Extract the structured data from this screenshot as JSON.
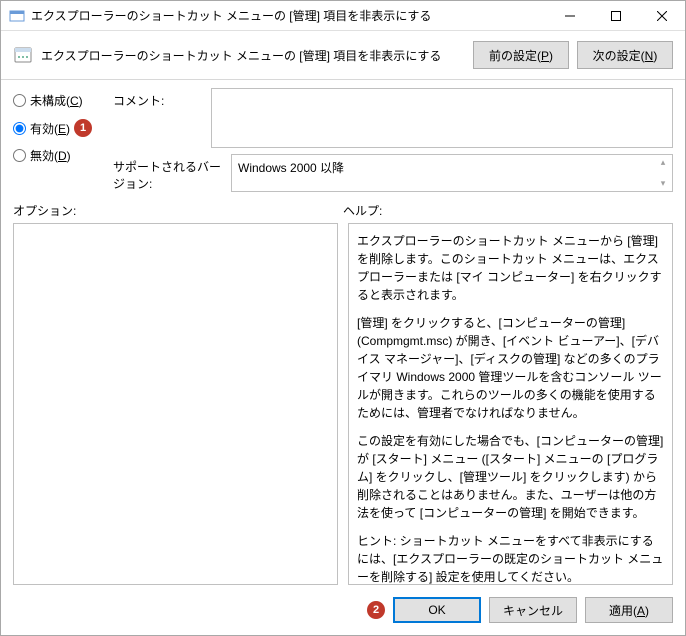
{
  "window": {
    "title": "エクスプローラーのショートカット メニューの [管理] 項目を非表示にする"
  },
  "header": {
    "title": "エクスプローラーのショートカット メニューの [管理] 項目を非表示にする",
    "prev_button": "前の設定(P)",
    "next_button": "次の設定(N)"
  },
  "radios": {
    "not_configured": "未構成(C)",
    "enabled": "有効(E)",
    "disabled": "無効(D)",
    "selected": "enabled",
    "badge1": "1"
  },
  "fields": {
    "comment_label": "コメント:",
    "comment_value": "",
    "supported_label": "サポートされるバージョン:",
    "supported_value": "Windows 2000 以降"
  },
  "labels": {
    "options": "オプション:",
    "help": "ヘルプ:"
  },
  "help": {
    "p1": "エクスプローラーのショートカット メニューから [管理] を削除します。このショートカット メニューは、エクスプローラーまたは [マイ コンピューター] を右クリックすると表示されます。",
    "p2": "[管理] をクリックすると、[コンピューターの管理] (Compmgmt.msc) が開き、[イベント ビューアー]、[デバイス マネージャー]、[ディスクの管理] などの多くのプライマリ Windows 2000 管理ツールを含むコンソール ツールが開きます。これらのツールの多くの機能を使用するためには、管理者でなければなりません。",
    "p3": "この設定を有効にした場合でも、[コンピューターの管理] が [スタート] メニュー ([スタート] メニューの [プログラム] をクリックし、[管理ツール] をクリックします) から削除されることはありません。また、ユーザーは他の方法を使って [コンピューターの管理] を開始できます。",
    "p4": "ヒント: ショートカット メニューをすべて非表示にするには、[エクスプローラーの既定のショートカット メニューを削除する] 設定を使用してください。"
  },
  "footer": {
    "badge2": "2",
    "ok": "OK",
    "cancel": "キャンセル",
    "apply": "適用(A)"
  }
}
